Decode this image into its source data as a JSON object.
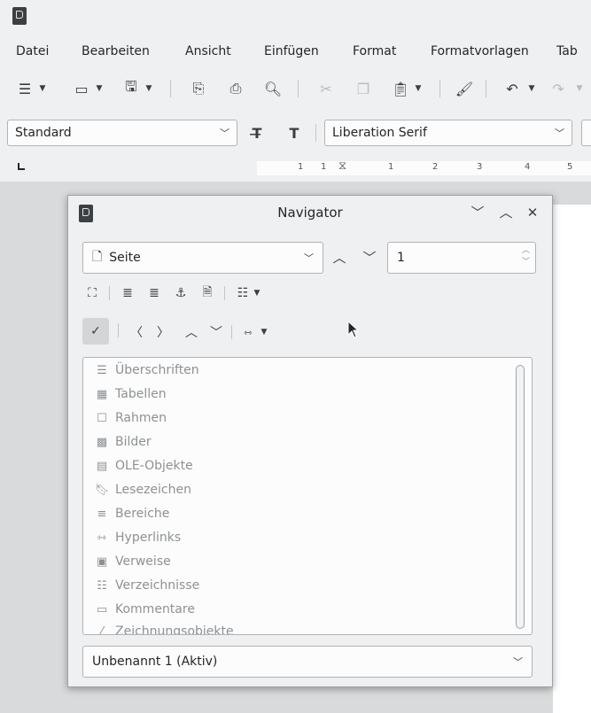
{
  "menubar": [
    "Datei",
    "Bearbeiten",
    "Ansicht",
    "Einfügen",
    "Format",
    "Formatvorlagen",
    "Tab"
  ],
  "toolbar2": {
    "paragraph_style": "Standard",
    "font_name": "Liberation Serif"
  },
  "ruler": {
    "numbers": [
      "1",
      "1",
      "1",
      "2",
      "3",
      "4",
      "5"
    ]
  },
  "navigator": {
    "title": "Navigator",
    "navigate_by": "Seite",
    "page_number": "1",
    "items": [
      {
        "label": "Überschriften",
        "icon": "headings-icon"
      },
      {
        "label": "Tabellen",
        "icon": "tables-icon"
      },
      {
        "label": "Rahmen",
        "icon": "frames-icon"
      },
      {
        "label": "Bilder",
        "icon": "images-icon"
      },
      {
        "label": "OLE-Objekte",
        "icon": "ole-objects-icon"
      },
      {
        "label": "Lesezeichen",
        "icon": "bookmarks-icon"
      },
      {
        "label": "Bereiche",
        "icon": "sections-icon"
      },
      {
        "label": "Hyperlinks",
        "icon": "hyperlinks-icon"
      },
      {
        "label": "Verweise",
        "icon": "references-icon"
      },
      {
        "label": "Verzeichnisse",
        "icon": "indexes-icon"
      },
      {
        "label": "Kommentare",
        "icon": "comments-icon"
      },
      {
        "label": "Zeichnungsobjekte",
        "icon": "drawing-objects-icon"
      }
    ],
    "document_select": "Unbenannt 1 (Aktiv)"
  },
  "colors": {
    "window_bg": "#eff0f1",
    "field_bg": "#fcfcfc",
    "disabled_text": "#8d9194",
    "text": "#232629"
  }
}
